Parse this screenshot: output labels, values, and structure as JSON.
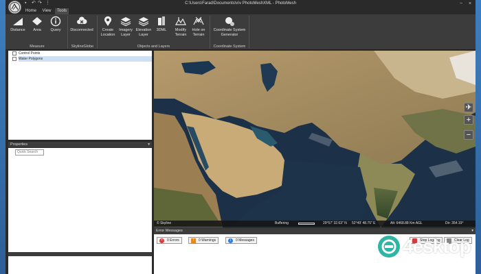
{
  "window": {
    "title": "C:\\Users\\Farad\\Documents\\v\\v PhotoMeshXML - PhotoMesh"
  },
  "tabs": [
    {
      "label": "Home",
      "active": false
    },
    {
      "label": "View",
      "active": false
    },
    {
      "label": "Tools",
      "active": true
    }
  ],
  "ribbon": {
    "buttons": [
      {
        "label": "Distance",
        "icon": "ruler-icon"
      },
      {
        "label": "Area",
        "icon": "area-icon"
      },
      {
        "label": "Query",
        "icon": "info-icon"
      },
      {
        "label": "Disconnected",
        "icon": "cloud-disconnected-icon"
      },
      {
        "label": "Create\nLocation",
        "icon": "location-pin-icon"
      },
      {
        "label": "Imagery\nLayer",
        "icon": "layers-icon"
      },
      {
        "label": "Elevation\nLayer",
        "icon": "elevation-layers-icon"
      },
      {
        "label": "3DML",
        "icon": "3dml-icon"
      },
      {
        "label": "Modify\nTerrain",
        "icon": "modify-terrain-icon"
      },
      {
        "label": "Hole on\nTerrain",
        "icon": "hole-terrain-icon"
      },
      {
        "label": "Coordinate System\nGenerator",
        "icon": "coordinate-generator-icon"
      }
    ],
    "groups": [
      "Measure",
      "SkylineGlobe",
      "Objects and Layers",
      "Coordinate System"
    ]
  },
  "tree": {
    "items": [
      {
        "label": "Control Points",
        "selected": false
      },
      {
        "label": "Water Polygons",
        "selected": true
      }
    ]
  },
  "properties": {
    "title": "Properties",
    "search_placeholder": "Quick Search"
  },
  "map": {
    "copyright": "© Skyline",
    "buffering_label": "Buffering",
    "lat": "29°57' 32.63\" N",
    "lon": "52°49' 48.75\" E",
    "alt": "Alt: 6468.88 Km AGL",
    "dir": "Dir: 354.19°"
  },
  "errors": {
    "title": "Error Messages",
    "errors_label": "0 Errors",
    "warnings_label": "0 Warnings",
    "messages_label": "0 Messages",
    "stop_logging_label": "Stop Logging",
    "clear_log_label": "Clear Log"
  },
  "watermark": {
    "text": "4esktop"
  },
  "colors": {
    "ribbon": "#3c3c3c",
    "panel_header": "#3c3c3c",
    "selection": "#cfe0f5"
  }
}
